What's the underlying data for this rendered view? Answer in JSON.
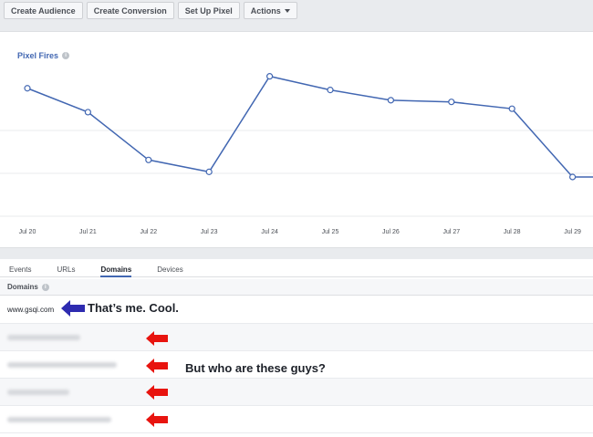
{
  "toolbar": {
    "buttons": [
      "Create Audience",
      "Create Conversion",
      "Set Up Pixel",
      "Actions"
    ]
  },
  "chart_title": "Pixel Fires",
  "chart_data": {
    "type": "line",
    "title": "Pixel Fires",
    "categories": [
      "Jul 20",
      "Jul 21",
      "Jul 22",
      "Jul 23",
      "Jul 24",
      "Jul 25",
      "Jul 26",
      "Jul 27",
      "Jul 28",
      "Jul 29"
    ],
    "values": [
      0.75,
      0.61,
      0.33,
      0.26,
      0.82,
      0.74,
      0.68,
      0.67,
      0.63,
      0.23
    ],
    "extends_right": 0.23,
    "grid": true,
    "line_color": "#4267b2"
  },
  "tabs": [
    {
      "label": "Events",
      "active": false
    },
    {
      "label": "URLs",
      "active": false
    },
    {
      "label": "Domains",
      "active": true
    },
    {
      "label": "Devices",
      "active": false
    }
  ],
  "domains_header": "Domains",
  "rows": [
    {
      "domain": "www.gsqi.com",
      "blurred": false
    },
    {
      "domain": "",
      "blurred": true
    },
    {
      "domain": "",
      "blurred": true
    },
    {
      "domain": "",
      "blurred": true
    },
    {
      "domain": "",
      "blurred": true
    }
  ],
  "annotations": {
    "first": "That’s me. Cool.",
    "second": "But who are these guys?"
  },
  "colors": {
    "accent": "#4267b2",
    "arrow_blue": "#2e2bb0",
    "arrow_red": "#e8140f"
  }
}
